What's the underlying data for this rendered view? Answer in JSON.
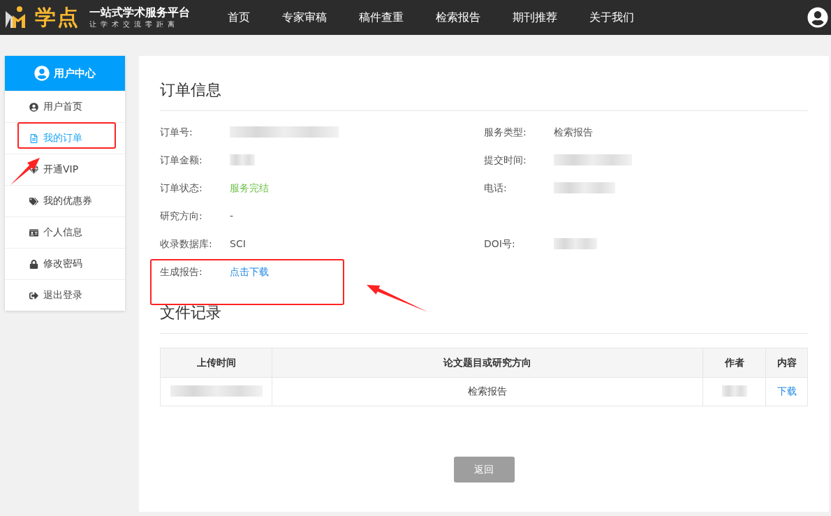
{
  "logo": {
    "name": "学点",
    "slogan": "一站式学术服务平台",
    "motto": "让学术交流零距离"
  },
  "nav": [
    {
      "label": "首页"
    },
    {
      "label": "专家审稿"
    },
    {
      "label": "稿件查重"
    },
    {
      "label": "检索报告"
    },
    {
      "label": "期刊推荐"
    },
    {
      "label": "关于我们"
    }
  ],
  "sidebar": {
    "title": "用户中心",
    "items": [
      {
        "label": "用户首页",
        "selected": false
      },
      {
        "label": "我的订单",
        "selected": true
      },
      {
        "label": "开通VIP",
        "selected": false
      },
      {
        "label": "我的优惠券",
        "selected": false
      },
      {
        "label": "个人信息",
        "selected": false
      },
      {
        "label": "修改密码",
        "selected": false
      },
      {
        "label": "退出登录",
        "selected": false
      }
    ]
  },
  "order": {
    "title": "订单信息",
    "rows": [
      {
        "left": {
          "label": "订单号:",
          "kind": "redacted"
        },
        "right": {
          "label": "服务类型:",
          "kind": "text",
          "value": "检索报告"
        }
      },
      {
        "left": {
          "label": "订单金额:",
          "kind": "redacted"
        },
        "right": {
          "label": "提交时间:",
          "kind": "redacted"
        }
      },
      {
        "left": {
          "label": "订单状态:",
          "kind": "status",
          "value": "服务完结"
        },
        "right": {
          "label": "电话:",
          "kind": "redacted"
        }
      },
      {
        "left": {
          "label": "研究方向:",
          "kind": "text",
          "value": "-"
        }
      },
      {
        "left": {
          "label": "收录数据库:",
          "kind": "text",
          "value": "SCI"
        },
        "right": {
          "label": "DOI号:",
          "kind": "redacted"
        }
      },
      {
        "left": {
          "label": "生成报告:",
          "kind": "link",
          "value": "点击下载"
        }
      }
    ]
  },
  "files": {
    "title": "文件记录",
    "columns": [
      "上传时间",
      "论文题目或研究方向",
      "作者",
      "内容"
    ],
    "rows": [
      [
        {
          "kind": "redacted"
        },
        {
          "kind": "text",
          "value": "检索报告"
        },
        {
          "kind": "redacted"
        },
        {
          "kind": "link",
          "value": "下载"
        }
      ]
    ]
  },
  "back_button": {
    "label": "返回",
    "disabled": true
  }
}
